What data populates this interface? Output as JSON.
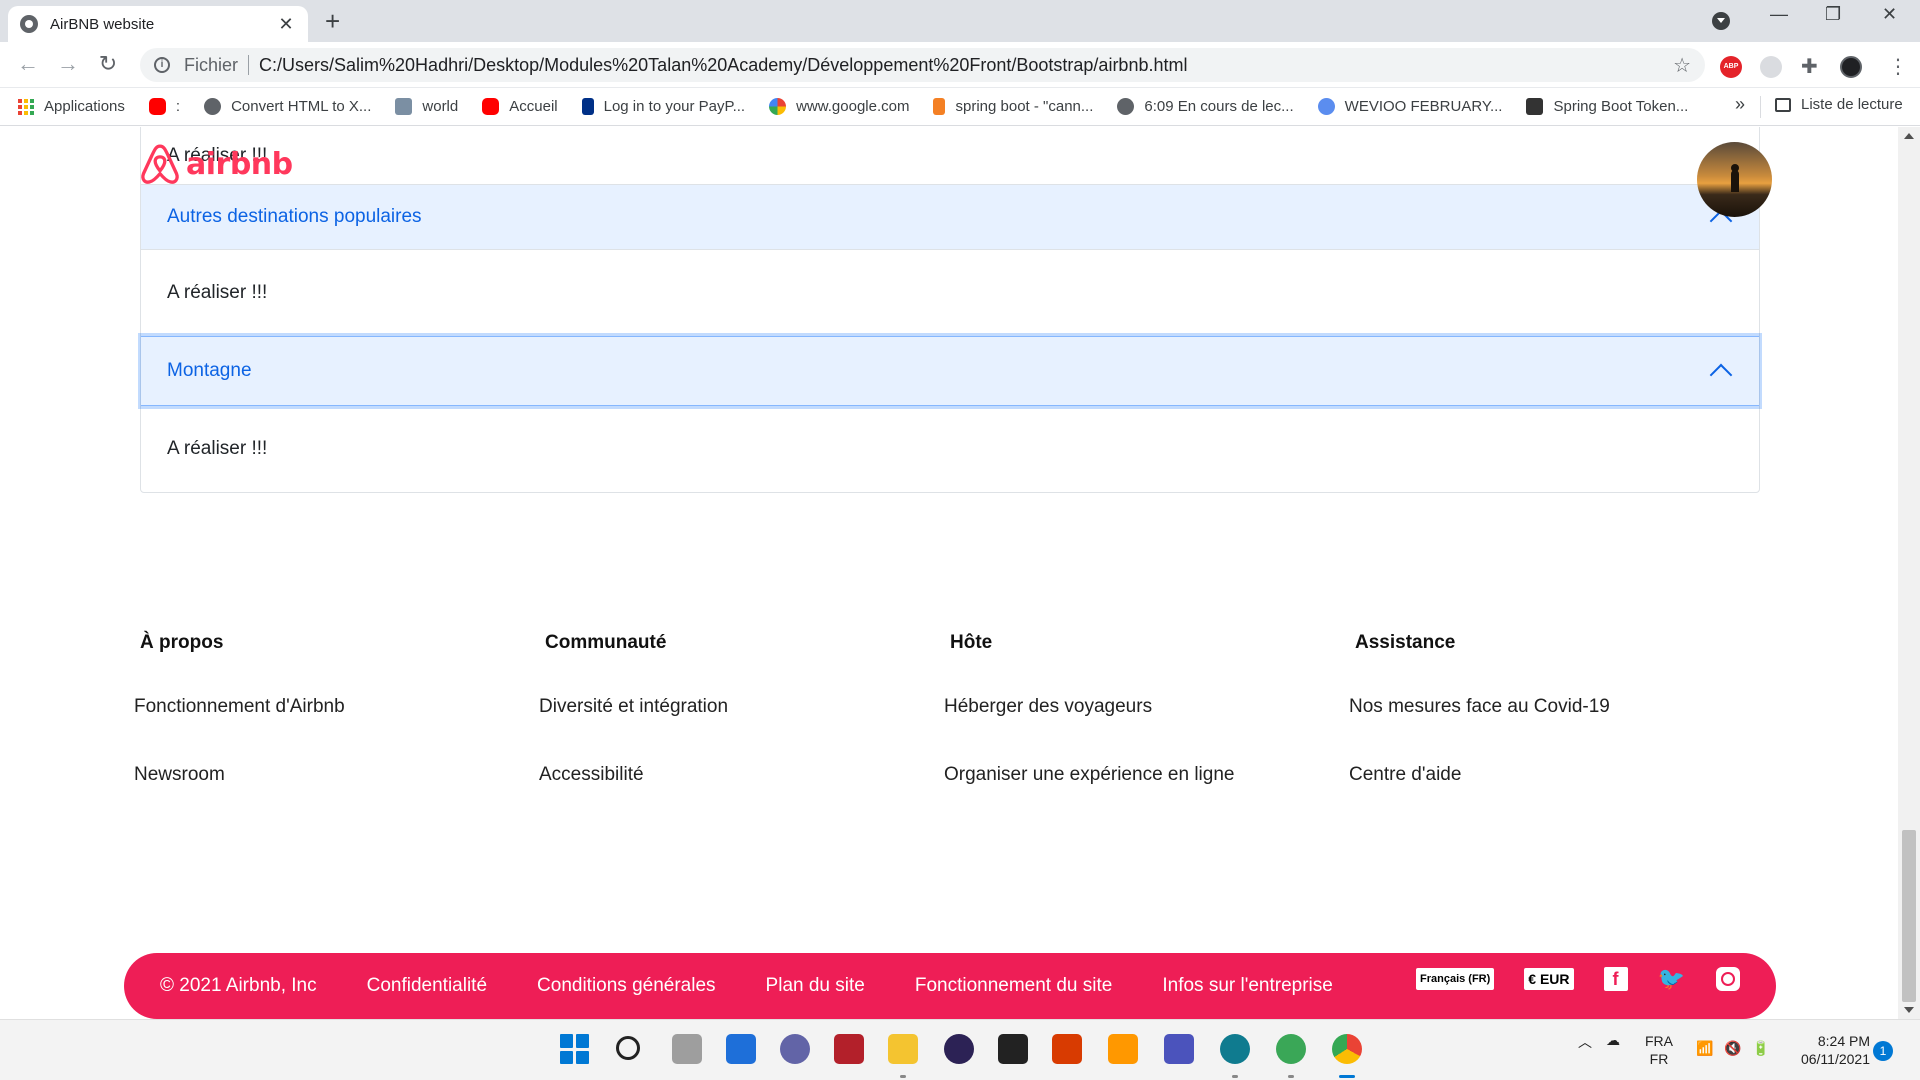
{
  "browser": {
    "tab_title": "AirBNB website",
    "scheme_label": "Fichier",
    "url": "C:/Users/Salim%20Hadhri/Desktop/Modules%20Talan%20Academy/Développement%20Front/Bootstrap/airbnb.html",
    "new_tab": "+",
    "close_tab": "✕",
    "window_controls": [
      "—",
      "❐",
      "✕"
    ]
  },
  "bookmarks": {
    "items": [
      {
        "label": "Applications",
        "icon": "apps-grid-icon"
      },
      {
        "label": ":",
        "icon": "youtube-icon",
        "color": "#ff0000"
      },
      {
        "label": "Convert HTML to X...",
        "icon": "globe-icon",
        "color": "#5f6368"
      },
      {
        "label": "world",
        "icon": "world-image-icon",
        "color": "#7b8fa3"
      },
      {
        "label": "Accueil",
        "icon": "youtube-icon",
        "color": "#ff0000"
      },
      {
        "label": "Log in to your PayP...",
        "icon": "paypal-icon",
        "color": "#003087"
      },
      {
        "label": "www.google.com",
        "icon": "google-icon",
        "color": "#4285f4"
      },
      {
        "label": "spring boot - \"cann...",
        "icon": "stackoverflow-icon",
        "color": "#f48024"
      },
      {
        "label": "6:09 En cours de lec...",
        "icon": "globe-icon",
        "color": "#5f6368"
      },
      {
        "label": "WEVIOO FEBRUARY...",
        "icon": "wevioo-icon",
        "color": "#5b8def"
      },
      {
        "label": "Spring Boot Token...",
        "icon": "zeta-icon",
        "color": "#333333"
      }
    ],
    "more": "»",
    "reading_list": "Liste de lecture"
  },
  "page": {
    "brand": "airbnb",
    "brand_color": "#ff385c",
    "accordion": {
      "top_body": "A réaliser !!!",
      "sections": [
        {
          "title": "Autres destinations populaires",
          "body": "A réaliser !!!"
        },
        {
          "title": "Montagne",
          "body": "A réaliser !!!"
        }
      ]
    },
    "footer": {
      "columns": [
        {
          "heading": "À propos",
          "links": [
            "Fonctionnement d'Airbnb",
            "Newsroom"
          ]
        },
        {
          "heading": "Communauté",
          "links": [
            "Diversité et intégration",
            "Accessibilité"
          ]
        },
        {
          "heading": "Hôte",
          "links": [
            "Héberger des voyageurs",
            "Organiser une expérience en ligne"
          ]
        },
        {
          "heading": "Assistance",
          "links": [
            "Nos mesures face au Covid-19",
            "Centre d'aide"
          ]
        }
      ],
      "bar": {
        "copyright": "© 2021 Airbnb, Inc",
        "links": [
          "Confidentialité",
          "Conditions générales",
          "Plan du site",
          "Fonctionnement du site",
          "Infos sur l'entreprise"
        ],
        "language": "Français (FR)",
        "currency": "€ EUR",
        "color": "#ee1e56",
        "social": [
          "facebook-icon",
          "twitter-icon",
          "instagram-icon"
        ]
      }
    }
  },
  "taskbar": {
    "lang_top": "FRA",
    "lang_bottom": "FR",
    "time": "8:24 PM",
    "date": "06/11/2021",
    "notifications": "1"
  }
}
